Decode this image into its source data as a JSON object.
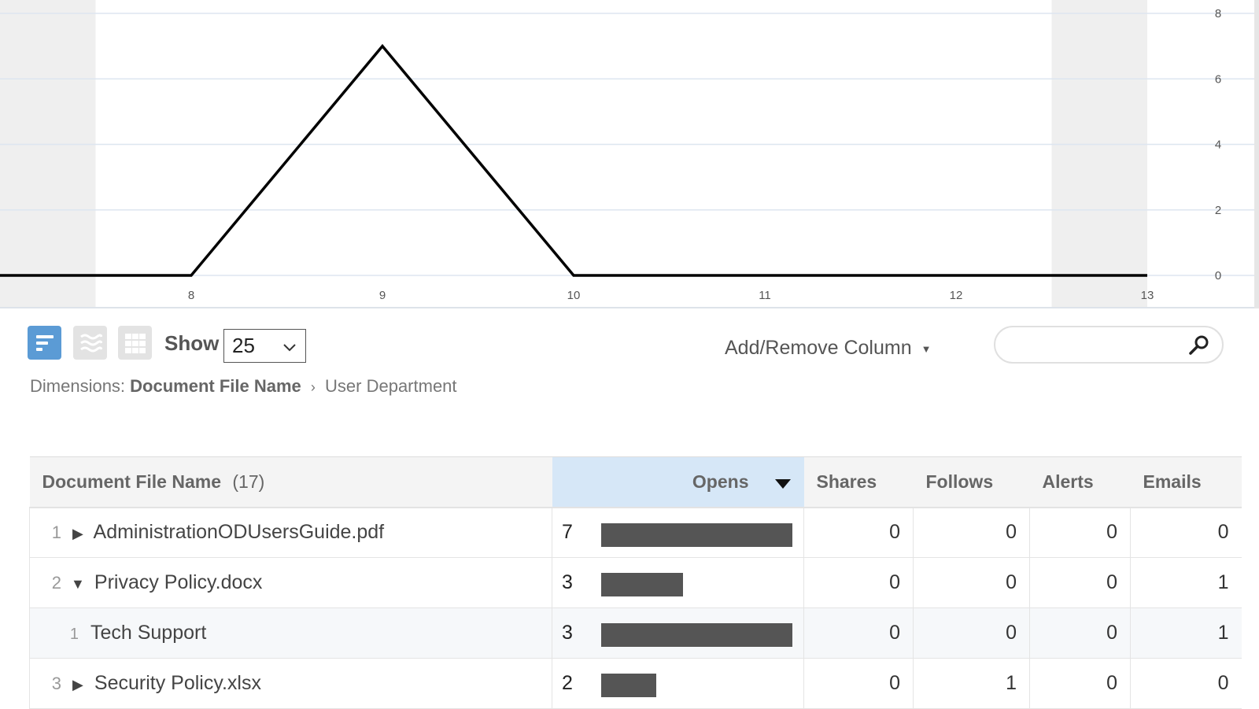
{
  "chart_data": {
    "type": "line",
    "x": [
      7,
      8,
      9,
      10,
      11,
      12,
      13
    ],
    "y": [
      0,
      0,
      7,
      0,
      0,
      0,
      0
    ],
    "xlim": [
      7,
      13
    ],
    "ylim": [
      0,
      8
    ],
    "x_ticks": [
      "8",
      "9",
      "10",
      "11",
      "12",
      "13"
    ],
    "y_ticks": [
      "0",
      "2",
      "4",
      "6",
      "8"
    ],
    "grid": true,
    "line_color": "#000000",
    "grid_color": "#dde6f0",
    "shaded_color": "#efefef",
    "title": "",
    "xlabel": "",
    "ylabel": ""
  },
  "toolbar": {
    "show_label": "Show",
    "page_size": "25",
    "add_remove_label": "Add/Remove Column",
    "search_placeholder": "",
    "view_icons": [
      "table-view-icon",
      "trend-view-icon",
      "grid-view-icon"
    ],
    "accent_color": "#5b9bd5"
  },
  "dimensions": {
    "label": "Dimensions:",
    "primary": "Document File Name",
    "separator": "›",
    "secondary": "User Department"
  },
  "table": {
    "headers": {
      "name": "Document File Name",
      "count": "(17)",
      "opens": "Opens",
      "shares": "Shares",
      "follows": "Follows",
      "alerts": "Alerts",
      "emails": "Emails"
    },
    "rows": [
      {
        "index": "1",
        "toggle": "▶",
        "name": "AdministrationODUsersGuide.pdf",
        "opens": "7",
        "opens_fraction": 1.0,
        "shares": "0",
        "follows": "0",
        "alerts": "0",
        "emails": "0"
      },
      {
        "index": "2",
        "toggle": "▼",
        "name": "Privacy Policy.docx",
        "opens": "3",
        "opens_fraction": 0.43,
        "shares": "0",
        "follows": "0",
        "alerts": "0",
        "emails": "1"
      },
      {
        "index": "1",
        "toggle": "",
        "name": "Tech Support",
        "opens": "3",
        "opens_fraction": 1.0,
        "shares": "0",
        "follows": "0",
        "alerts": "0",
        "emails": "1"
      },
      {
        "index": "3",
        "toggle": "▶",
        "name": "Security Policy.xlsx",
        "opens": "2",
        "opens_fraction": 0.29,
        "shares": "0",
        "follows": "1",
        "alerts": "0",
        "emails": "0"
      }
    ]
  }
}
